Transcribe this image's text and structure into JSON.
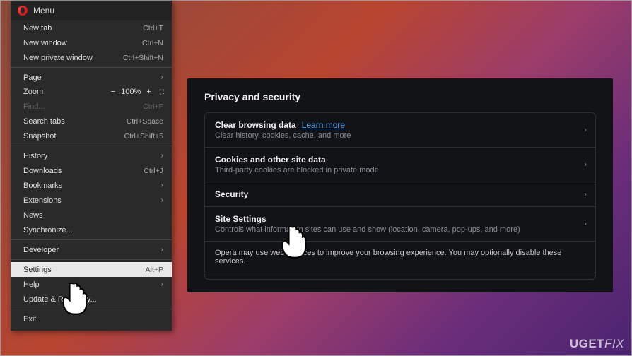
{
  "menu": {
    "title": "Menu",
    "items": {
      "new_tab": {
        "label": "New tab",
        "shortcut": "Ctrl+T"
      },
      "new_window": {
        "label": "New window",
        "shortcut": "Ctrl+N"
      },
      "new_private": {
        "label": "New private window",
        "shortcut": "Ctrl+Shift+N"
      },
      "page": {
        "label": "Page"
      },
      "zoom": {
        "label": "Zoom",
        "value": "100%"
      },
      "find": {
        "label": "Find...",
        "shortcut": "Ctrl+F"
      },
      "search_tabs": {
        "label": "Search tabs",
        "shortcut": "Ctrl+Space"
      },
      "snapshot": {
        "label": "Snapshot",
        "shortcut": "Ctrl+Shift+5"
      },
      "history": {
        "label": "History"
      },
      "downloads": {
        "label": "Downloads",
        "shortcut": "Ctrl+J"
      },
      "bookmarks": {
        "label": "Bookmarks"
      },
      "extensions": {
        "label": "Extensions"
      },
      "news": {
        "label": "News"
      },
      "synchronize": {
        "label": "Synchronize..."
      },
      "developer": {
        "label": "Developer"
      },
      "settings": {
        "label": "Settings",
        "shortcut": "Alt+P"
      },
      "help": {
        "label": "Help"
      },
      "update": {
        "label": "Update & Recovery..."
      },
      "exit": {
        "label": "Exit"
      }
    }
  },
  "settings": {
    "section_title": "Privacy and security",
    "items": {
      "clear": {
        "title": "Clear browsing data",
        "link": "Learn more",
        "desc": "Clear history, cookies, cache, and more"
      },
      "cookies": {
        "title": "Cookies and other site data",
        "desc": "Third-party cookies are blocked in private mode"
      },
      "security": {
        "title": "Security"
      },
      "site": {
        "title": "Site Settings",
        "desc": "Controls what information sites can use and show (location, camera, pop-ups, and more)"
      }
    },
    "info": "Opera may use web services to improve your browsing experience. You may optionally disable these services."
  },
  "watermark": {
    "left": "UGET",
    "right": "FIX"
  }
}
